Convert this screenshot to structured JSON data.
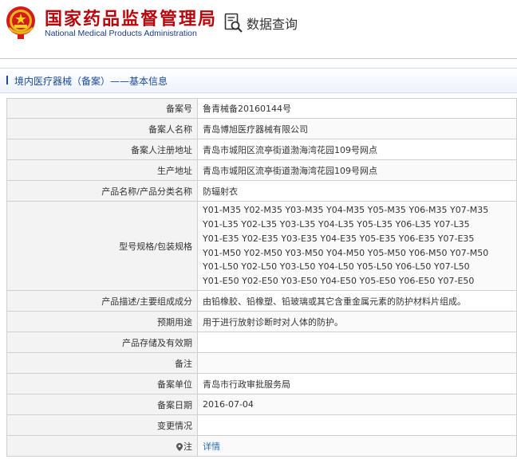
{
  "header": {
    "title_cn": "国家药品监督管理局",
    "title_en": "National Medical Products Administration",
    "query_label": "数据查询"
  },
  "breadcrumb": {
    "text": "境内医疗器械（备案）——基本信息"
  },
  "record": {
    "rows": [
      {
        "label": "备案号",
        "value": "鲁青械备20160144号"
      },
      {
        "label": "备案人名称",
        "value": "青岛博旭医疗器械有限公司"
      },
      {
        "label": "备案人注册地址",
        "value": "青岛市城阳区流亭街道渤海湾花园109号网点"
      },
      {
        "label": "生产地址",
        "value": "青岛市城阳区流亭街道渤海湾花园109号网点"
      },
      {
        "label": "产品名称/产品分类名称",
        "value": "防辐射衣"
      },
      {
        "label": "型号规格/包装规格",
        "lines": [
          "Y01-M35 Y02-M35 Y03-M35 Y04-M35 Y05-M35 Y06-M35 Y07-M35",
          "Y01-L35 Y02-L35 Y03-L35 Y04-L35 Y05-L35 Y06-L35 Y07-L35",
          "Y01-E35 Y02-E35 Y03-E35 Y04-E35 Y05-E35 Y06-E35 Y07-E35",
          "Y01-M50 Y02-M50 Y03-M50 Y04-M50 Y05-M50 Y06-M50 Y07-M50",
          "Y01-L50 Y02-L50 Y03-L50 Y04-L50 Y05-L50 Y06-L50 Y07-L50",
          "Y01-E50 Y02-E50 Y03-E50 Y04-E50 Y05-E50 Y06-E50 Y07-E50"
        ]
      },
      {
        "label": "产品描述/主要组成成分",
        "value": "由铅橡胶、铅橡塑、铅玻璃或其它含重金属元素的防护材料片组成。"
      },
      {
        "label": "预期用途",
        "value": "用于进行放射诊断时对人体的防护。"
      },
      {
        "label": "产品存储及有效期",
        "value": ""
      },
      {
        "label": "备注",
        "value": ""
      },
      {
        "label": "备案单位",
        "value": "青岛市行政审批服务局"
      },
      {
        "label": "备案日期",
        "value": "2016-07-04"
      },
      {
        "label": "变更情况",
        "value": ""
      },
      {
        "label": "注",
        "value": "详情"
      }
    ]
  },
  "colors": {
    "brand_red": "#b8070c",
    "brand_blue": "#1b3a8a",
    "link": "#2a6bc9"
  },
  "icons": {
    "emblem": "national-emblem-icon",
    "query": "search-document-icon",
    "breadcrumb": "breadcrumb-marker-icon",
    "note": "location-pin-icon"
  }
}
